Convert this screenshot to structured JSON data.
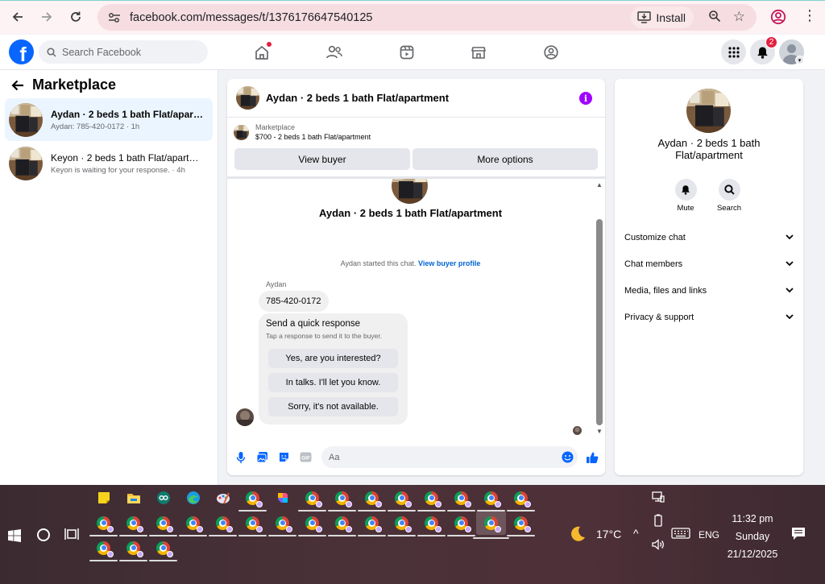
{
  "browser": {
    "url": "facebook.com/messages/t/1376176647540125",
    "install_label": "Install"
  },
  "fb_header": {
    "search_placeholder": "Search Facebook",
    "notification_count": "2"
  },
  "left_panel": {
    "title": "Marketplace",
    "conversations": [
      {
        "title": "Aydan · 2 beds 1 bath Flat/apartm...",
        "subtitle": "Aydan: 785-420-0172 · 1h",
        "active": true
      },
      {
        "title": "Keyon · 2 beds 1 bath Flat/apartm...",
        "subtitle": "Keyon is waiting for your response. · 4h",
        "active": false
      }
    ]
  },
  "chat": {
    "header_title": "Aydan · 2 beds 1 bath Flat/apartment",
    "listing_label": "Marketplace",
    "listing_detail": "$700 - 2 beds 1 bath Flat/apartment",
    "view_buyer_label": "View buyer",
    "more_options_label": "More options",
    "thread_title": "Aydan · 2 beds 1 bath Flat/apartment",
    "started_text": "Aydan started this chat. ",
    "view_profile_link": "View buyer profile",
    "sender_name": "Aydan",
    "message_phone": "785-420-0172",
    "quick_title": "Send a quick response",
    "quick_hint": "Tap a response to send it to the buyer.",
    "quick_replies": [
      "Yes, are you interested?",
      "In talks. I'll let you know.",
      "Sorry, it's not available."
    ],
    "input_placeholder": "Aa"
  },
  "right_panel": {
    "name": "Aydan · 2 beds 1 bath Flat/apartment",
    "mute_label": "Mute",
    "search_label": "Search",
    "sections": [
      "Customize chat",
      "Chat members",
      "Media, files and links",
      "Privacy & support"
    ]
  },
  "taskbar": {
    "temperature": "17°C",
    "language": "ENG",
    "time": "11:32 pm",
    "day": "Sunday",
    "date": "21/12/2025"
  },
  "colors": {
    "facebook_blue": "#0866ff",
    "link_blue": "#0064d1",
    "badge_red": "#e41e3f",
    "info_purple": "#a100ff",
    "taskbar": "#4a3138"
  }
}
